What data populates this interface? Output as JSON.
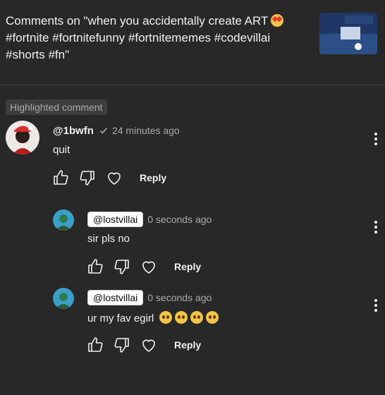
{
  "header": {
    "line1": "Comments on \"when you accidentally create ART",
    "line2": "#fortnite #fortnitefunny #fortnitememes #codevillai",
    "line3": "#shorts #fn\"",
    "thumbnail_caption": "accidentally create ART"
  },
  "highlight_badge": "Highlighted comment",
  "comments": [
    {
      "handle": "@1bwfn",
      "verified_icon": "check-icon",
      "time": "24 minutes ago",
      "text": "quit",
      "reply_label": "Reply"
    },
    {
      "handle": "@lostvillai",
      "time": "0 seconds ago",
      "text": "sir pls no",
      "reply_label": "Reply"
    },
    {
      "handle": "@lostvillai",
      "time": "0 seconds ago",
      "text": "ur my fav egirl",
      "reply_label": "Reply"
    }
  ],
  "colors": {
    "background": "#282828",
    "text": "#f1f1f1",
    "muted": "#aaaaaa",
    "divider": "#3f3f3f"
  }
}
